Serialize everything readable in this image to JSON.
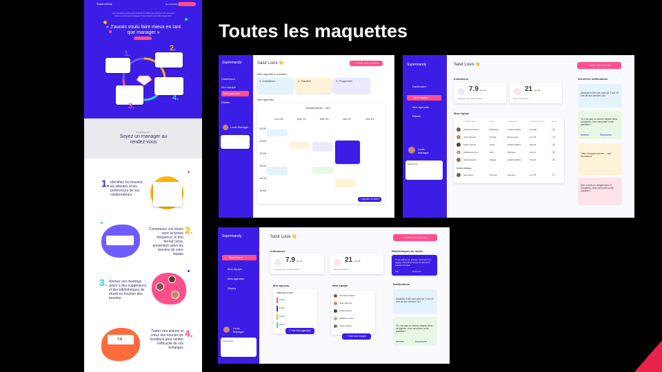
{
  "slide": {
    "title": "Toutes les maquettes",
    "accent_color": "#3c1de6",
    "pink_color": "#ff4f8b",
    "corner_color": "#e8224b"
  },
  "landing": {
    "logo": "Supermandy",
    "nav_link": "Se connecter",
    "intro": "Les managers interrogés indiquent à 85% que lorsque l’on veut faire mieux en tant que manager, il faut savoir se rendre disponible.",
    "quote": "« J’aurais voulu faire mieux en tant que manager »",
    "cta": "Essayer gratuitement",
    "steps": [
      "1.",
      "2.",
      "3.",
      "4."
    ],
    "section_kicker": "SUPERMANDY",
    "section_title": "Soyez un manager au rendez-vous",
    "features": [
      {
        "num": "1.",
        "text": "Identifiez les besoins, les attentes et les préférences de vos collaborateurs"
      },
      {
        "num": "2.",
        "text": "Construisez vos rituels avec la bonne fréquence, le bon format (visio, présentiel) selon les besoins de votre équipe"
      },
      {
        "num": "3.",
        "text": "Animez vos meetings grâce à des suggestions et des bibliothèques de rituels en fonction des besoins"
      },
      {
        "num": "4.",
        "text": "Testez des actions et créez des boucles de feedback pour vérifier l’efficacité de vos échanges"
      }
    ],
    "feature4_stat": "7.9"
  },
  "mock1": {
    "logo": "Supermandy",
    "greeting": "Salut Louis 👋",
    "new_button": "+ Créer une réunion",
    "nav": [
      "Dashboard",
      "Mon équipe",
      "Mes agendas",
      "Rituels"
    ],
    "active_index": 2,
    "section_title": "Mes objectifs & priorités",
    "goals": [
      "1. Collaborer",
      "2. Planifier",
      "3. Progresser"
    ],
    "agenda_title": "Mes agendas",
    "views": [
      "Semaine",
      "Mois",
      "Jour"
    ],
    "days": [
      "Lun 18",
      "Mar 19",
      "Mer 20",
      "Jeu 21",
      "Ven 22"
    ],
    "hours": [
      "10:00",
      "11:00",
      "12:00",
      "13:00",
      "14:00",
      "15:00"
    ],
    "user": "Louis Manager",
    "fab": "+ Ajouter un rituel"
  },
  "mock2": {
    "logo": "Supermandy",
    "greeting": "Salut Louis 👋",
    "new_button": "+ Créer une réunion",
    "nav": [
      "Dashboard",
      "Mon équipe",
      "Mes agendas",
      "Rituels"
    ],
    "active_index": 1,
    "indicators_title": "Indicateurs",
    "kpis": [
      {
        "value": "7.9",
        "unit": "sur 10",
        "label": "Engagement collaborateurs"
      },
      {
        "value": "21",
        "unit": "sur 20",
        "label": "Meeting réalisés"
      }
    ],
    "team_title": "Mon équipe",
    "team_columns": [
      "Collaborateur",
      "Rôle",
      "Fréquence",
      "Prochain rituel",
      "Score"
    ],
    "team_rows": [
      [
        "Alexandra Martin",
        "Marketing",
        "Hebdomadaire",
        "Demain",
        "8"
      ],
      [
        "Julien Bonnet",
        "Produit",
        "Bi-mensuel",
        "Lun 18",
        "7"
      ],
      [
        "Adèle Garnier",
        "Sales",
        "Hebdomadaire",
        "Mar 19",
        "9"
      ],
      [
        "Matthieu Leroux",
        "Tech",
        "Mensuel",
        "Jeu 21",
        "6"
      ],
      [
        "Claire Dupont",
        "Design",
        "Hebdomadaire",
        "Ven 22",
        "8"
      ]
    ],
    "archive_title": "Autres équipes",
    "archive_rows": [
      [
        "Jules Roux",
        "Finance",
        "Mensuel",
        "Lun 25",
        "7"
      ]
    ],
    "notif_title": "Dernières notifications",
    "notifs": [
      {
        "text": "Amanda a été une note de 7 sur 10 lors de son dernier 1&1",
        "color": "#e3f2fb"
      },
      {
        "text": "Tu n’as pas vu Jimmy depuis deux semaines. Une rencontre a été planifiée !",
        "color": "#e8f7e3"
      },
      {
        "text": "Julia n’est pas encore ... ses formations",
        "color": "#fdf3d9"
      },
      {
        "text": "Alex a écrit un weight dans 3 semaines. Une rencontre a été planifiée !",
        "color": "#fde3ea"
      }
    ],
    "notif_actions": [
      "Annuler",
      "Reprioriser"
    ],
    "user": "Louis Manager",
    "widget_label": "Aujourd’hui"
  },
  "mock3": {
    "logo": "Supermandy",
    "greeting": "Salut Louis 👋",
    "new_button": "+ Créer une réunion",
    "nav": [
      "Dashboard",
      "Mon équipe",
      "Mes agendas",
      "Rituels"
    ],
    "active_index": 0,
    "indicators_title": "Indicateurs",
    "kpis": [
      {
        "value": "7.9",
        "unit": "sur 10",
        "label": "Engagement collaborateurs"
      },
      {
        "value": "21",
        "unit": "sur 20",
        "label": "Meeting réalisés"
      }
    ],
    "library_title": "Bibliothèques de rituels",
    "library_text": "Tu as réalisé ton premier rituel avec ton équipe ! Prends le temps de découvrir d’autres formats.",
    "library_actions": [
      "Voir",
      "Découvrir"
    ],
    "agenda_title": "Mes agenda",
    "agenda_sub": "Meetings à venir",
    "meeting_times": [
      "10:00",
      "11:30",
      "14:00",
      "16:00"
    ],
    "agenda_button": "+ Voir mes agendas",
    "team_title": "Mon équipe",
    "team_names": [
      "Alexandra Martin",
      "Julien Bonnet",
      "Adèle Garnier",
      "Matthieu Leroux",
      "Claire Dupont"
    ],
    "team_button": "+ Voir mon équipe",
    "notif_title": "Notifications",
    "notifs": [
      {
        "text": "Amanda a été une note de 7 sur 10 lors de son dernier 1&1",
        "color": "#e3f2fb"
      },
      {
        "text": "Tu n’as pas vu Jimmy depuis deux semaines. Une rencontre a été planifiée !",
        "color": "#e8f7e3"
      }
    ],
    "notif_actions": [
      "Annuler",
      "Reprioriser"
    ],
    "user": "Louis Manager",
    "widget_label": "Aujourd’hui"
  }
}
